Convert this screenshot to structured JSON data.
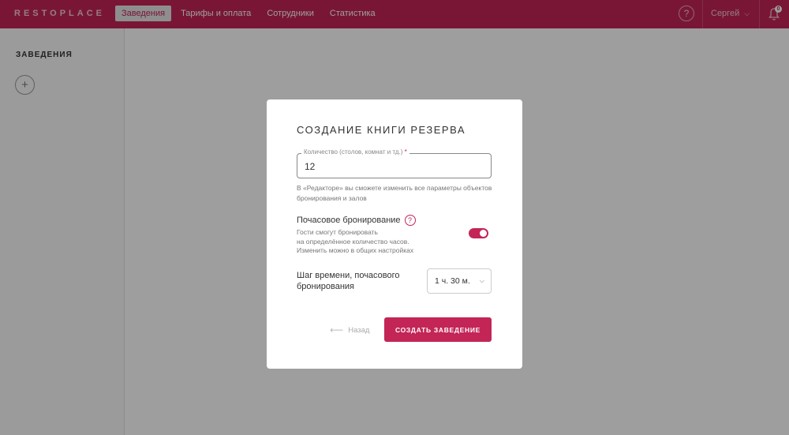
{
  "app": {
    "logo": "RESTOPLACE"
  },
  "nav": {
    "items": [
      {
        "label": "Заведения",
        "active": true
      },
      {
        "label": "Тарифы и оплата",
        "active": false
      },
      {
        "label": "Сотрудники",
        "active": false
      },
      {
        "label": "Статистика",
        "active": false
      }
    ],
    "help_icon": "?",
    "user_name": "Сергей",
    "notification_count": "0"
  },
  "sidebar": {
    "title": "ЗАВЕДЕНИЯ",
    "add_icon": "+"
  },
  "modal": {
    "title": "СОЗДАНИЕ КНИГИ РЕЗЕРВА",
    "quantity_field": {
      "label": "Количество (столов, комнат и тд.)",
      "required_mark": "*",
      "value": "12"
    },
    "hint": "В «Редакторе» вы сможете изменить все параметры объектов бронирования и залов",
    "hourly": {
      "title": "Почасовое бронирование",
      "help_icon": "?",
      "description_lines": [
        "Гости смогут бронировать",
        "на определённое количество часов.",
        "Изменить можно в общих настройках"
      ],
      "enabled": true
    },
    "time_step": {
      "label": "Шаг времени, почасового бронирования",
      "selected": "1 ч. 30 м."
    },
    "back_label": "Назад",
    "back_icon": "⟵",
    "create_label": "СОЗДАТЬ ЗАВЕДЕНИЕ"
  },
  "colors": {
    "brand": "#c32557",
    "overlay": "rgba(0,0,0,0.38)"
  }
}
